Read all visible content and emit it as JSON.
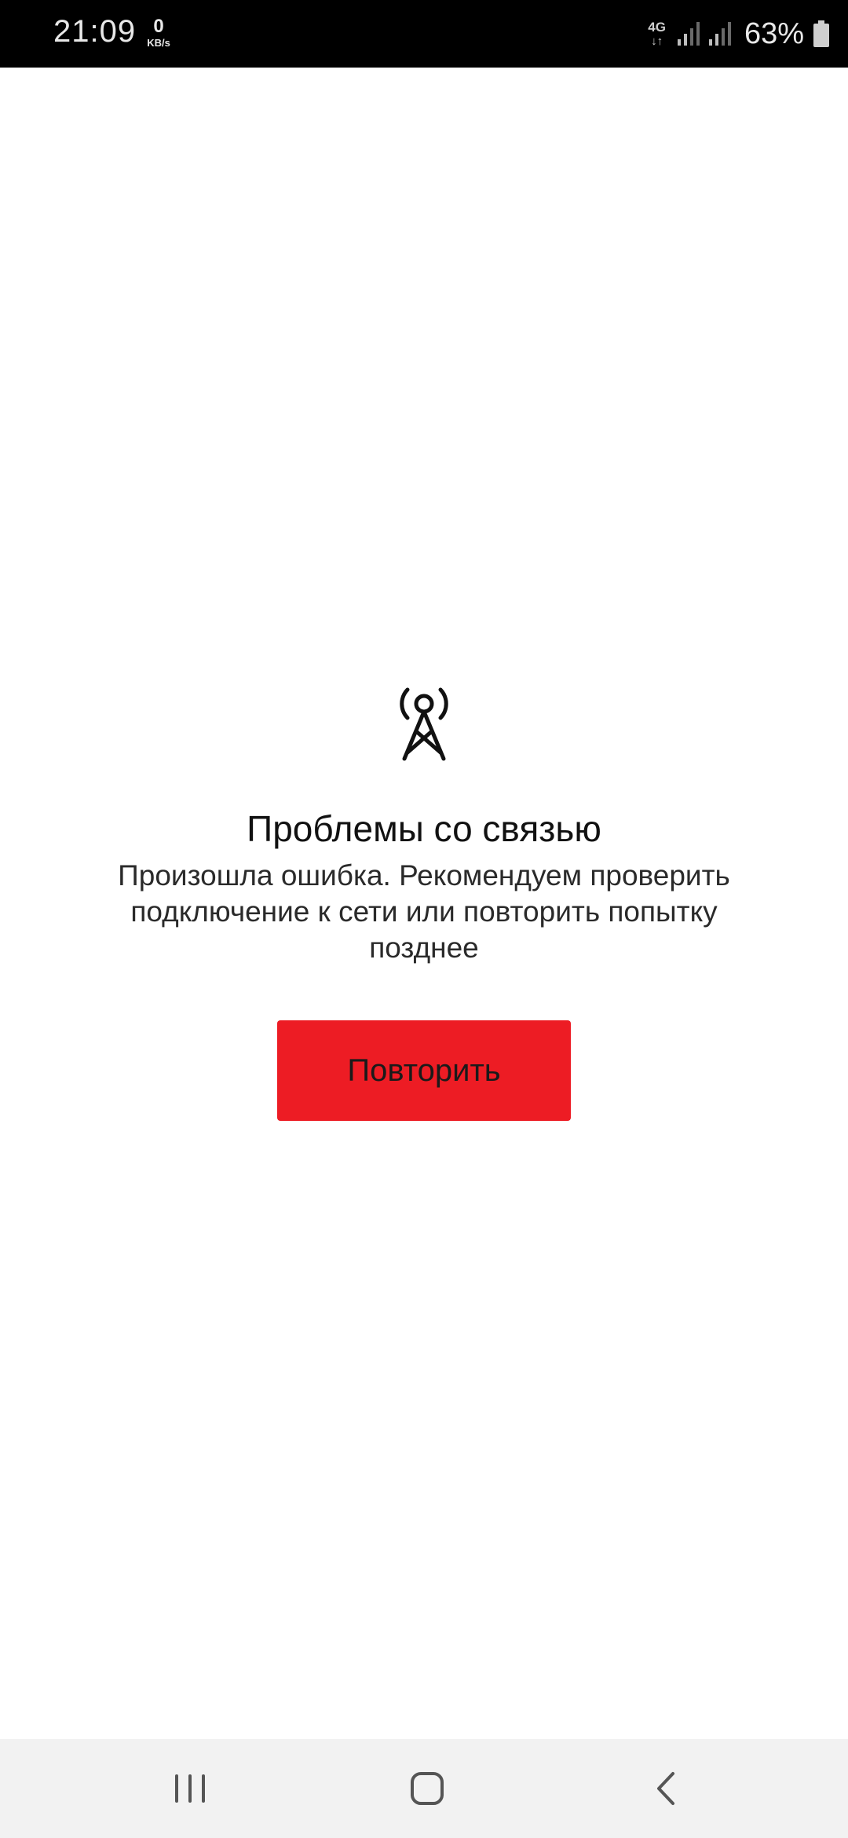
{
  "status_bar": {
    "time": "21:09",
    "speed_value": "0",
    "speed_unit": "KB/s",
    "network_type": "4G",
    "network_arrows": "↓↑",
    "battery_percent": "63%"
  },
  "error": {
    "icon": "radio-tower-icon",
    "title": "Проблемы со связью",
    "message": "Произошла ошибка. Рекомендуем проверить подключение к сети или повторить попытку позднее"
  },
  "retry_button": {
    "label": "Повторить",
    "color": "#ed1c24"
  },
  "nav_bar": {
    "recents": "recents-icon",
    "home": "home-icon",
    "back": "back-icon"
  }
}
